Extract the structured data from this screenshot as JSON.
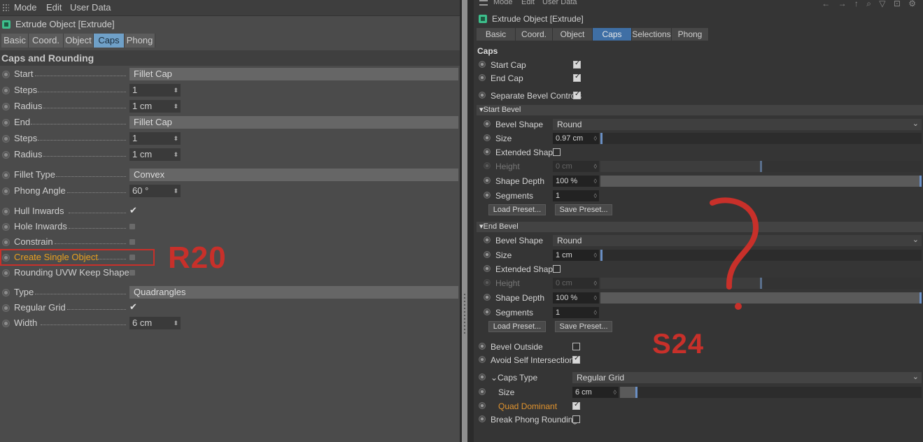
{
  "left": {
    "menu": [
      "Mode",
      "Edit",
      "User Data"
    ],
    "title": "Extrude Object [Extrude]",
    "tabs": [
      "Basic",
      "Coord.",
      "Object",
      "Caps",
      "Phong"
    ],
    "active_tab": "Caps",
    "section": "Caps and Rounding",
    "rows": {
      "start": {
        "label": "Start",
        "value": "Fillet Cap"
      },
      "steps1": {
        "label": "Steps",
        "value": "1"
      },
      "radius1": {
        "label": "Radius",
        "value": "1 cm"
      },
      "end": {
        "label": "End",
        "value": "Fillet Cap"
      },
      "steps2": {
        "label": "Steps",
        "value": "1"
      },
      "radius2": {
        "label": "Radius",
        "value": "1 cm"
      },
      "fillet_type": {
        "label": "Fillet Type",
        "value": "Convex"
      },
      "phong_angle": {
        "label": "Phong Angle",
        "value": "60 °"
      },
      "hull_inwards": {
        "label": "Hull Inwards",
        "mark": "✔"
      },
      "hole_inwards": {
        "label": "Hole Inwards"
      },
      "constrain": {
        "label": "Constrain"
      },
      "create_single": {
        "label": "Create Single Object"
      },
      "rounding_uvw": {
        "label": "Rounding UVW Keep Shape"
      },
      "type": {
        "label": "Type",
        "value": "Quadrangles"
      },
      "regular_grid": {
        "label": "Regular Grid",
        "mark": "✔"
      },
      "width": {
        "label": "Width",
        "value": "6 cm"
      }
    },
    "annotation": "R20"
  },
  "right": {
    "menu": [
      "Mode",
      "Edit",
      "User Data"
    ],
    "title": "Extrude Object [Extrude]",
    "tabs": [
      "Basic",
      "Coord.",
      "Object",
      "Caps",
      "Selections",
      "Phong"
    ],
    "active_tab": "Caps",
    "section": "Caps",
    "start_cap": "Start Cap",
    "end_cap": "End Cap",
    "separate_bevel": "Separate Bevel Controls",
    "start_bevel": {
      "header": "Start Bevel",
      "bevel_shape": {
        "label": "Bevel Shape",
        "value": "Round"
      },
      "size": {
        "label": "Size",
        "value": "0.97 cm"
      },
      "extended_shape": "Extended Shape",
      "height": {
        "label": "Height",
        "value": "0 cm"
      },
      "shape_depth": {
        "label": "Shape Depth",
        "value": "100 %"
      },
      "segments": {
        "label": "Segments",
        "value": "1"
      },
      "load_preset": "Load Preset...",
      "save_preset": "Save Preset..."
    },
    "end_bevel": {
      "header": "End Bevel",
      "bevel_shape": {
        "label": "Bevel Shape",
        "value": "Round"
      },
      "size": {
        "label": "Size",
        "value": "1 cm"
      },
      "extended_shape": "Extended Shape",
      "height": {
        "label": "Height",
        "value": "0 cm"
      },
      "shape_depth": {
        "label": "Shape Depth",
        "value": "100 %"
      },
      "segments": {
        "label": "Segments",
        "value": "1"
      },
      "load_preset": "Load Preset...",
      "save_preset": "Save Preset..."
    },
    "bevel_outside": "Bevel Outside",
    "avoid_self": "Avoid Self Intersections",
    "caps_type": {
      "label": "Caps Type",
      "value": "Regular Grid"
    },
    "caps_size": {
      "label": "Size",
      "value": "6 cm"
    },
    "quad_dominant": "Quad Dominant",
    "break_phong": "Break Phong Rounding",
    "annotation": "S24"
  },
  "colors": {
    "accent_tab": "#6fa0c8",
    "annotation_red": "#c8302a",
    "highlight_orange": "#e0932e"
  }
}
